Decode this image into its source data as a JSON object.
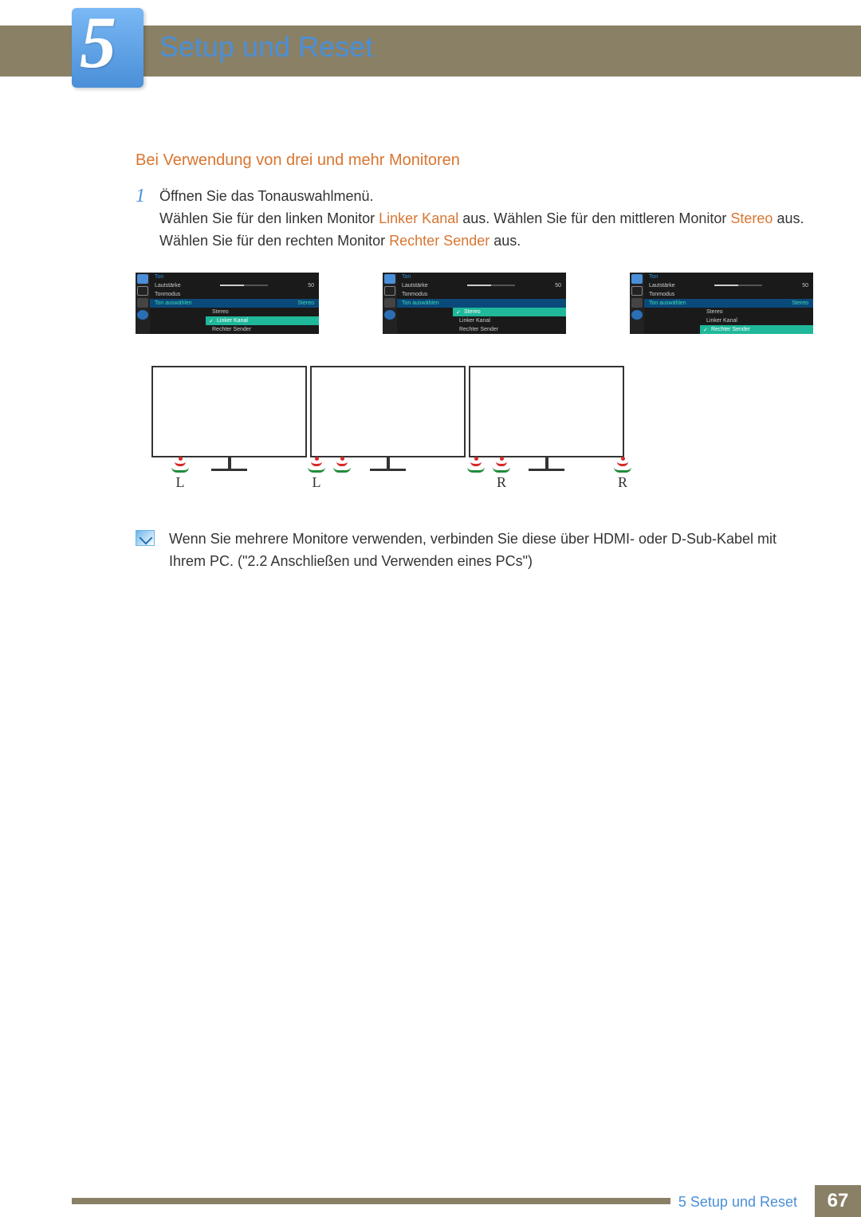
{
  "chapter": {
    "number": "5",
    "title": "Setup und Reset"
  },
  "section": {
    "heading": "Bei Verwendung von drei und mehr Monitoren"
  },
  "step": {
    "number": "1",
    "text1": "Öffnen Sie das Tonauswahlmenü.",
    "text2a": "Wählen Sie für den linken Monitor ",
    "hl1": "Linker Kanal",
    "text2b": " aus. Wählen Sie für den mittleren Monitor ",
    "hl2": "Stereo",
    "text2c": " aus. Wählen Sie für den rechten Monitor ",
    "hl3": "Rechter Sender",
    "text2d": " aus."
  },
  "menu": {
    "title": "Ton",
    "row1": "Lautstärke",
    "val1": "50",
    "row2": "Tonmodus",
    "row3": "Ton auswählen",
    "opt1": "Stereo",
    "opt2": "Linker Kanal",
    "opt3": "Rechter Sender"
  },
  "speakers": {
    "L": "L",
    "R": "R"
  },
  "note": "Wenn Sie mehrere Monitore verwenden, verbinden Sie diese über HDMI- oder D-Sub-Kabel mit Ihrem PC. (\"2.2 Anschließen und Verwenden eines PCs\")",
  "footer": {
    "label": "5 Setup und Reset",
    "page": "67"
  }
}
